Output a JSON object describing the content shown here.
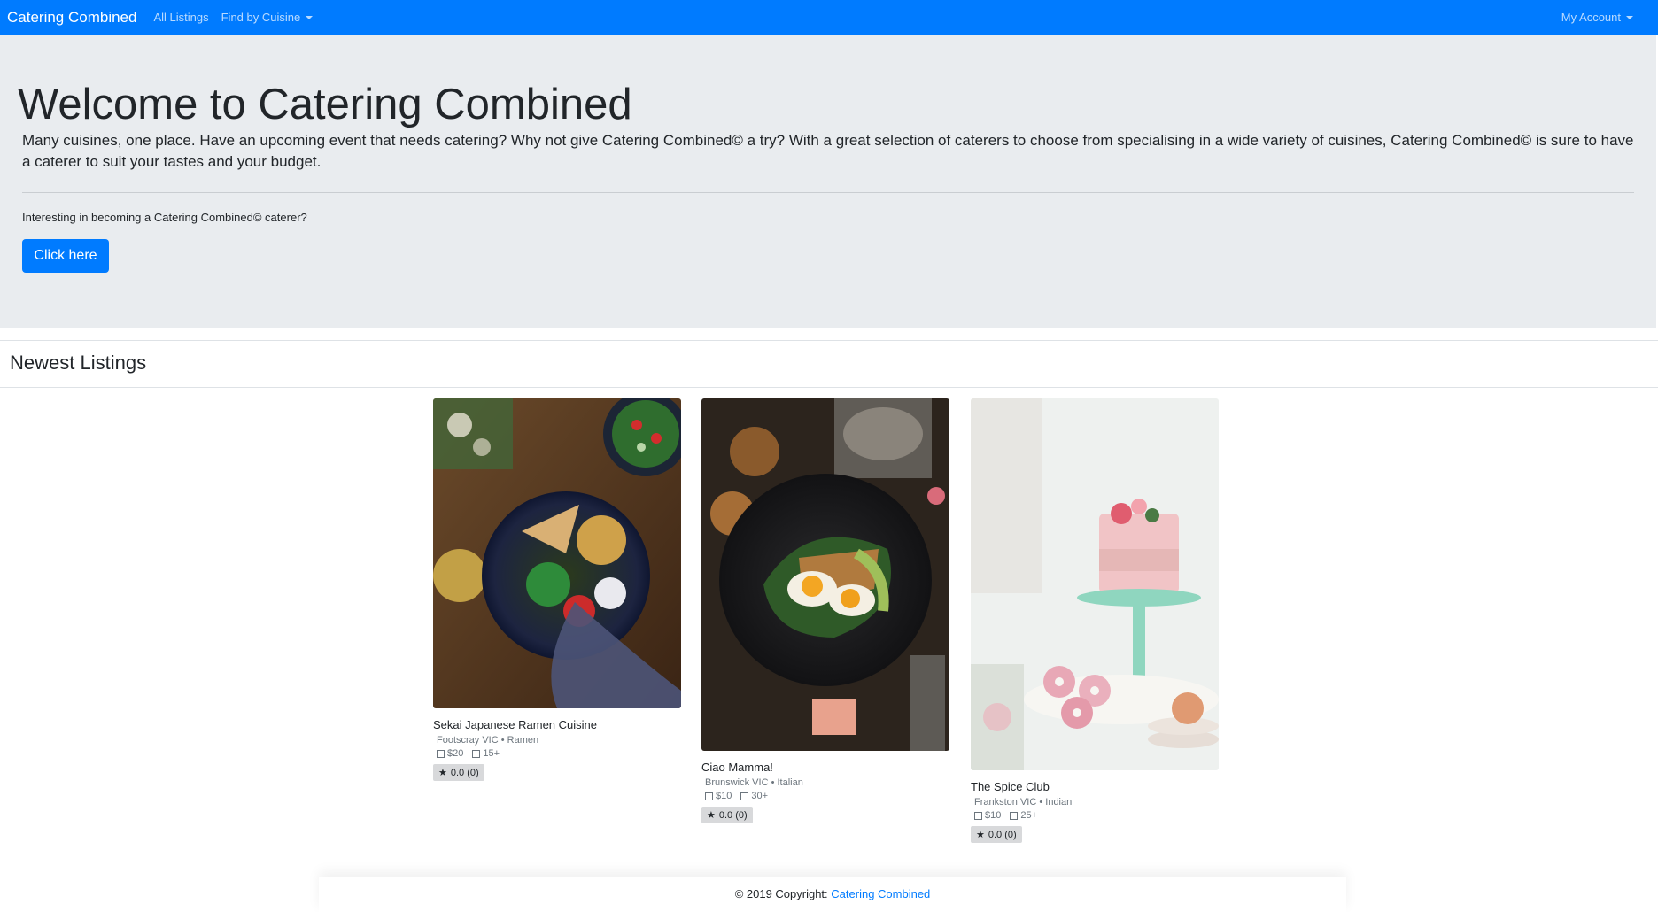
{
  "navbar": {
    "brand": "Catering Combined",
    "all_listings": "All Listings",
    "find_by_cuisine": "Find by Cuisine",
    "my_account": "My Account"
  },
  "hero": {
    "title": "Welcome to Catering Combined",
    "lead": "Many cuisines, one place. Have an upcoming event that needs catering? Why not give Catering Combined© a try? With a great selection of caterers to choose from specialising in a wide variety of cuisines, Catering Combined© is sure to have a caterer to suit your tastes and your budget.",
    "interest_text": "Interesting in becoming a Catering Combined© caterer?",
    "button_label": "Click here"
  },
  "newest": {
    "heading": "Newest Listings",
    "listings": [
      {
        "name": "Sekai Japanese Ramen Cuisine",
        "location": "Footscray VIC • Ramen",
        "price": "$20",
        "guests": "15+",
        "rating": "0.0 (0)",
        "image": "bowl-of-salad-and-chickpeas-photo"
      },
      {
        "name": "Ciao Mamma!",
        "location": "Brunswick VIC • Italian",
        "price": "$10",
        "guests": "30+",
        "rating": "0.0 (0)",
        "image": "eggs-and-avocado-toast-photo"
      },
      {
        "name": "The Spice Club",
        "location": "Frankston VIC • Indian",
        "price": "$10",
        "guests": "25+",
        "rating": "0.0 (0)",
        "image": "pink-cake-and-donuts-photo"
      }
    ]
  },
  "footer": {
    "copyright": "© 2019 Copyright: ",
    "link": "Catering Combined"
  },
  "colors": {
    "primary": "#007bff",
    "jumbotron": "#e9ecef"
  }
}
